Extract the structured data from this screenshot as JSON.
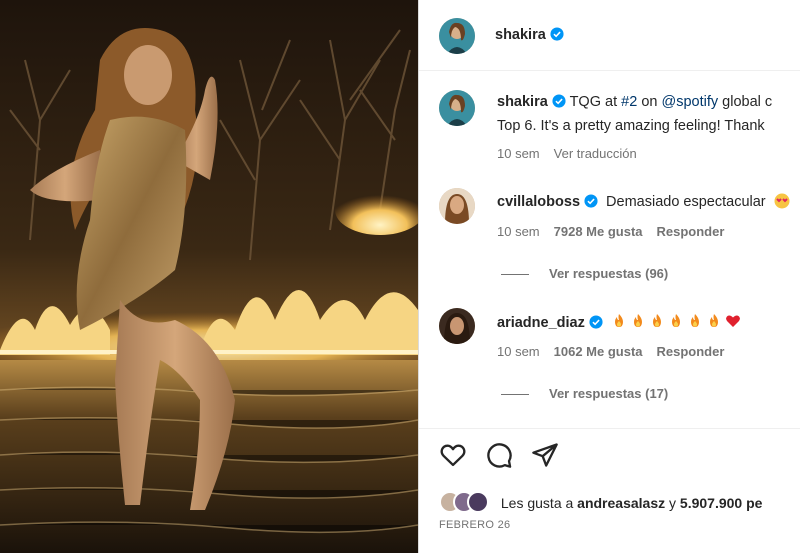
{
  "post_header": {
    "username": "shakira"
  },
  "caption": {
    "username": "shakira",
    "text_line1_a": "TQG at ",
    "hashtag": "#2",
    "text_line1_b": " on ",
    "mention": "@spotify",
    "text_line1_c": " global c",
    "text_line2": "Top 6. It's a pretty amazing feeling! Thank",
    "time": "10 sem",
    "translate": "Ver traducción"
  },
  "comments": [
    {
      "username": "cvillaloboss",
      "text": "Demasiado espectacular",
      "time": "10 sem",
      "likes": "7928 Me gusta",
      "reply": "Responder",
      "view_replies": "Ver respuestas (96)"
    },
    {
      "username": "ariadne_diaz",
      "emojis": [
        "fire-emoji",
        "fire-emoji",
        "fire-emoji",
        "fire-emoji",
        "fire-emoji",
        "fire-emoji",
        "red-heart-emoji"
      ],
      "time": "10 sem",
      "likes": "1062 Me gusta",
      "reply": "Responder",
      "view_replies": "Ver respuestas (17)"
    }
  ],
  "actions": {
    "icons": [
      "heart-icon",
      "comment-icon",
      "share-icon"
    ]
  },
  "likes": {
    "prefix": "Les gusta a ",
    "user": "andreasalasz",
    "middle": " y ",
    "count": "5.907.900 pe"
  },
  "date": "FEBRERO 26",
  "colors": {
    "verified": "#0095f6",
    "link": "#00376b",
    "muted": "#737373",
    "text": "#262626"
  }
}
